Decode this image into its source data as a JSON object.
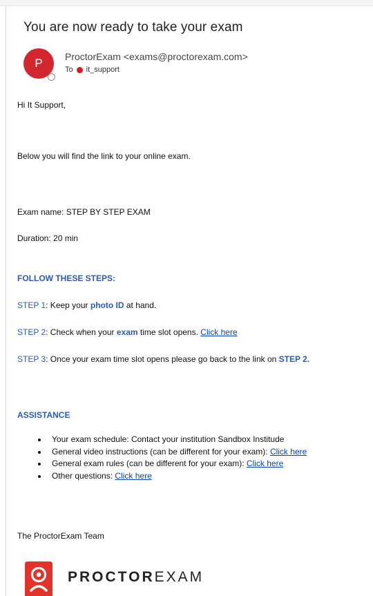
{
  "email": {
    "subject": "You are now ready to take your exam",
    "avatar_letter": "P",
    "from": "ProctorExam <exams@proctorexam.com>",
    "to_label": "To",
    "to_recipient": "it_support"
  },
  "body": {
    "greeting": "Hi It Support,",
    "intro": "Below you will find the link to your online exam.",
    "exam_name": "Exam name: STEP BY STEP EXAM",
    "duration": "Duration: 20 min",
    "steps_heading": "FOLLOW THESE STEPS:",
    "step1": {
      "label": "STEP 1",
      "pre": ": Keep your ",
      "highlight": "photo ID",
      "post": " at hand."
    },
    "step2": {
      "label": "STEP 2",
      "pre": ": Check when your ",
      "highlight": "exam",
      "post": " time slot opens. ",
      "link": "Click here"
    },
    "step3": {
      "label": "STEP 3",
      "pre": ": Once your exam time slot opens please go back to the link on ",
      "highlight": "STEP 2."
    },
    "assistance_heading": "ASSISTANCE",
    "assistance": [
      {
        "text": "Your exam schedule: Contact your institution Sandbox Institude",
        "link": ""
      },
      {
        "text": "General video instructions (can be different for your exam): ",
        "link": "Click here"
      },
      {
        "text": "General exam rules (can be different for your exam): ",
        "link": "Click here"
      },
      {
        "text": "Other questions: ",
        "link": "Click here"
      }
    ],
    "signoff": "The ProctorExam Team"
  },
  "brand": {
    "bold": "PROCTOR",
    "light": "EXAM"
  },
  "colors": {
    "avatar": "#d3262e",
    "accent_blue": "#2a5ab5",
    "link": "#0645ad",
    "logo_red": "#e2332a"
  }
}
